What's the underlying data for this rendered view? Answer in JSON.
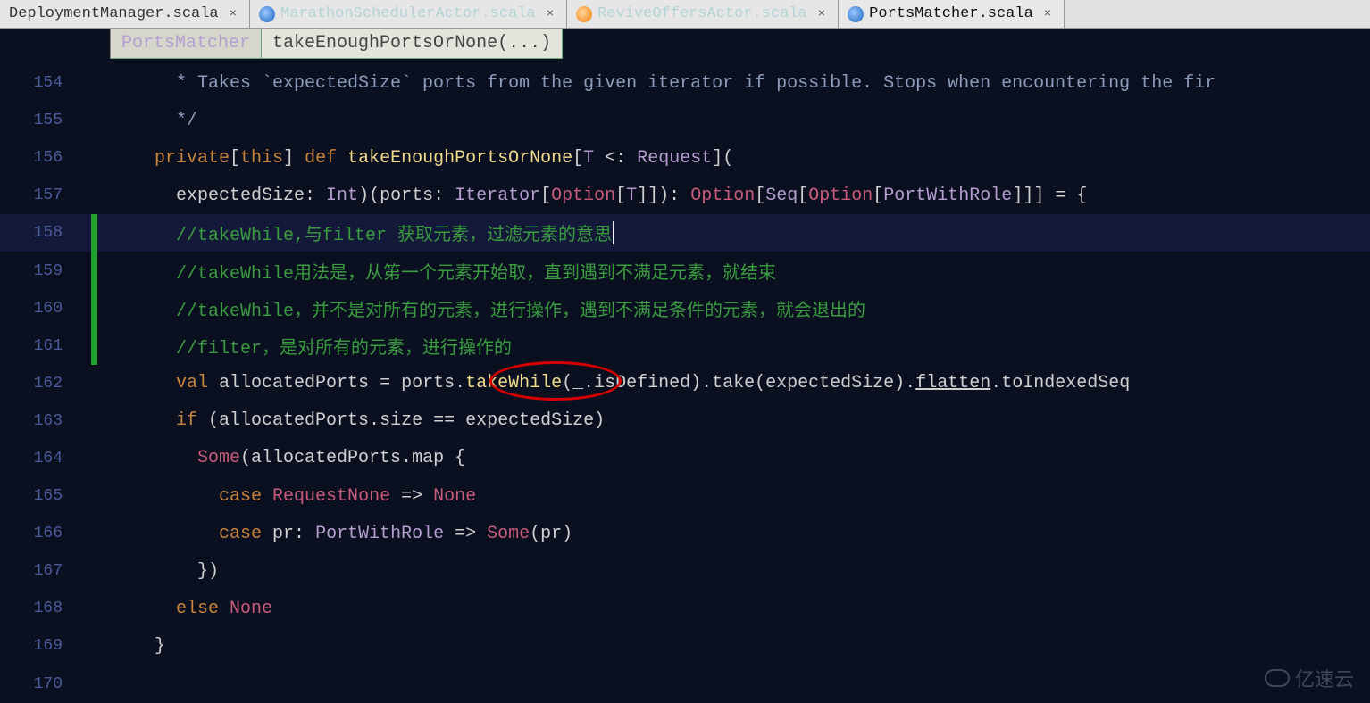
{
  "tabs": [
    {
      "label": "DeploymentManager.scala",
      "icon": "none",
      "active": false,
      "faded": false
    },
    {
      "label": "MarathonSchedulerActor.scala",
      "icon": "blue",
      "active": false,
      "faded": true
    },
    {
      "label": "ReviveOffersActor.scala",
      "icon": "orange",
      "active": false,
      "faded": true
    },
    {
      "label": "PortsMatcher.scala",
      "icon": "blue",
      "active": true,
      "faded": false
    }
  ],
  "breadcrumb": {
    "class": "PortsMatcher",
    "method": "takeEnoughPortsOrNone(...)"
  },
  "line_start": 154,
  "current_line": 158,
  "change_bar_lines": [
    158,
    159,
    160,
    161
  ],
  "lines": {
    "154": "      * Takes `expectedSize` ports from the given iterator if possible. Stops when encountering the fir",
    "155": "      */",
    "156_kw_priv": "private",
    "156_this": "[this]",
    "156_def": " def ",
    "156_fn": "takeEnoughPortsOrNone",
    "156_ty": "[T <: Request](",
    "157_a": "      expectedSize: ",
    "157_Int": "Int",
    "157_b": ")(ports: ",
    "157_It": "Iterator",
    "157_c": "[",
    "157_Opt": "Option",
    "157_d": "[",
    "157_T": "T",
    "157_e": "]]): ",
    "157_Opt2": "Option",
    "157_f": "[",
    "157_Seq": "Seq",
    "157_g": "[",
    "157_Opt3": "Option",
    "157_h": "[",
    "157_PWR": "PortWithRole",
    "157_i": "]]] = {",
    "158": "      //takeWhile,与filter 获取元素，过滤元素的意思",
    "159": "      //takeWhile用法是，从第一个元素开始取，直到遇到不满足元素，就结束",
    "160": "      //takeWhile，并不是对所有的元素，进行操作，遇到不满足条件的元素，就会退出的",
    "161": "      //filter，是对所有的元素，进行操作的",
    "162_val": "val ",
    "162_name": "allocatedPorts",
    "162_eq": " = ",
    "162_ports": "ports.",
    "162_tw": "takeWhile",
    "162_p": "(_.isDefined).take(expectedSize).",
    "162_fl": "flatten",
    "162_r": ".toIndexedSeq",
    "163_if": "if ",
    "163_p": "(allocatedPorts.size == expectedSize)",
    "164_s": "Some",
    "164_p": "(allocatedPorts.map {",
    "165_case": "case ",
    "165_rn": "RequestNone",
    "165_arr": " => ",
    "165_none": "None",
    "166_case": "case ",
    "166_pr": "pr: ",
    "166_pwr": "PortWithRole",
    "166_arr": " => ",
    "166_some": "Some",
    "166_p": "(pr)",
    "167": "        })",
    "168_else": "else ",
    "168_none": "None",
    "169": "    }"
  },
  "watermark": "亿速云"
}
